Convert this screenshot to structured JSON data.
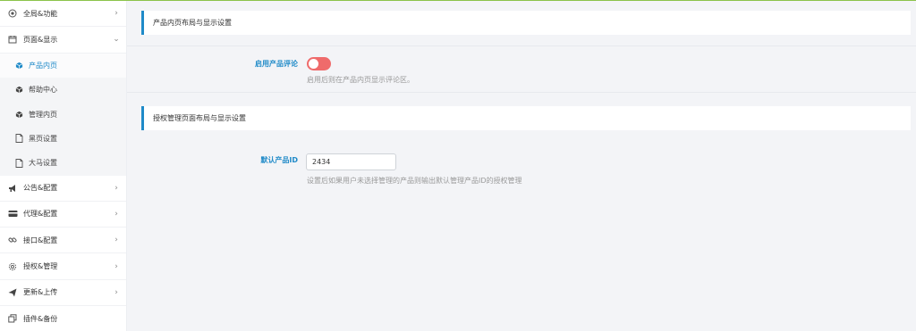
{
  "sidebar": {
    "items": [
      {
        "label": "全局&功能",
        "icon": "globe-icon",
        "chevron": "›"
      },
      {
        "label": "页面&显示",
        "icon": "calendar-icon",
        "chevron": "⌄"
      },
      {
        "label": "公告&配置",
        "icon": "megaphone-icon",
        "chevron": "›"
      },
      {
        "label": "代理&配置",
        "icon": "card-icon",
        "chevron": "›"
      },
      {
        "label": "接口&配置",
        "icon": "link-icon",
        "chevron": "›"
      },
      {
        "label": "授权&管理",
        "icon": "settings-icon",
        "chevron": "›"
      },
      {
        "label": "更新&上传",
        "icon": "send-icon",
        "chevron": "›"
      },
      {
        "label": "插件&备份",
        "icon": "copy-icon",
        "chevron": ""
      }
    ],
    "subitems": [
      {
        "label": "产品内页",
        "icon": "cube-icon",
        "active": true
      },
      {
        "label": "帮助中心",
        "icon": "cube-icon",
        "active": false
      },
      {
        "label": "管理内页",
        "icon": "cube-icon",
        "active": false
      },
      {
        "label": "黑页设置",
        "icon": "file-icon",
        "active": false
      },
      {
        "label": "大马设置",
        "icon": "file-icon",
        "active": false
      }
    ]
  },
  "sections": {
    "product": {
      "title": "产品内页布局与显示设置",
      "field_label": "启用产品评论",
      "toggle_on": true,
      "toggle_color": "#ef6b6b",
      "hint": "启用后则在产品内页显示评论区。"
    },
    "auth": {
      "title": "授权管理页面布局与显示设置",
      "field_label": "默认产品ID",
      "input_value": "2434",
      "hint": "设置后如果用户未选择管理的产品则输出默认管理产品ID的授权管理"
    }
  },
  "colors": {
    "accent": "#1f8ac8",
    "top_line": "#8bc34a"
  }
}
